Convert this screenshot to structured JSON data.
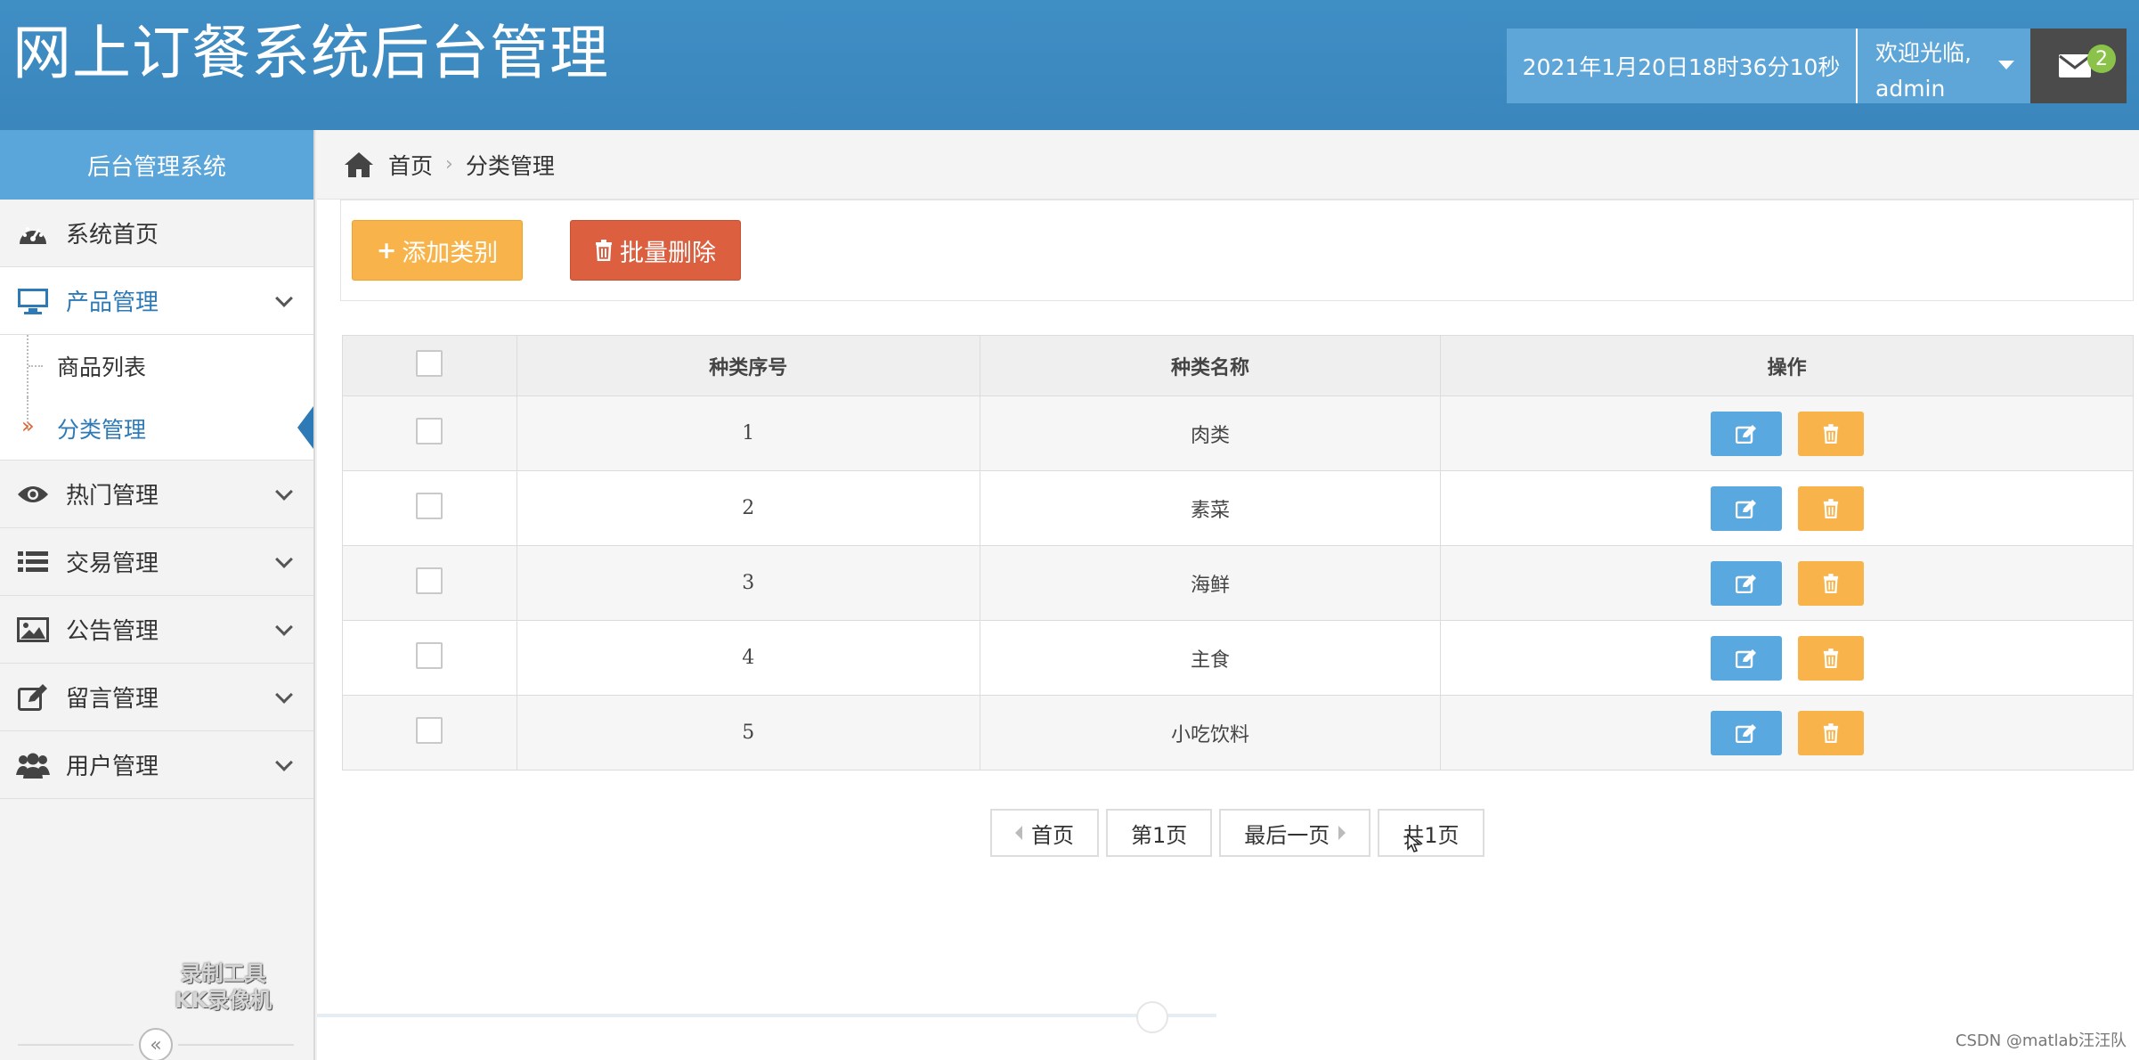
{
  "header": {
    "title": "网上订餐系统后台管理",
    "datetime": "2021年1月20日18时36分10秒",
    "welcome_line1": "欢迎光临,",
    "welcome_line2": "admin",
    "mail_count": "2"
  },
  "sidebar": {
    "title": "后台管理系统",
    "items": [
      {
        "label": "系统首页",
        "icon": "dashboard-icon"
      },
      {
        "label": "产品管理",
        "icon": "monitor-icon"
      },
      {
        "label": "热门管理",
        "icon": "eye-icon"
      },
      {
        "label": "交易管理",
        "icon": "list-icon"
      },
      {
        "label": "公告管理",
        "icon": "image-icon"
      },
      {
        "label": "留言管理",
        "icon": "edit-icon"
      },
      {
        "label": "用户管理",
        "icon": "users-icon"
      }
    ],
    "subitems": [
      {
        "label": "商品列表"
      },
      {
        "label": "分类管理"
      }
    ],
    "watermark_line1": "录制工具",
    "watermark_line2": "KK录像机",
    "collapse_glyph": "«"
  },
  "breadcrumb": {
    "home": "首页",
    "sep": "›",
    "current": "分类管理"
  },
  "toolbar": {
    "add_label": "添加类别",
    "add_icon": "+",
    "delete_label": "批量删除"
  },
  "table": {
    "columns": [
      "种类序号",
      "种类名称",
      "操作"
    ],
    "rows": [
      {
        "id": "1",
        "name": "肉类"
      },
      {
        "id": "2",
        "name": "素菜"
      },
      {
        "id": "3",
        "name": "海鲜"
      },
      {
        "id": "4",
        "name": "主食"
      },
      {
        "id": "5",
        "name": "小吃饮料"
      }
    ]
  },
  "pager": {
    "first": "首页",
    "current": "第1页",
    "last": "最后一页",
    "total": "共1页"
  },
  "footer": {
    "credit": "CSDN @matlab汪汪队"
  },
  "colors": {
    "header": "#3f8ec4",
    "accent": "#2d7ab7",
    "add_button": "#f8b44a",
    "delete_button": "#dc6040",
    "badge": "#8bc34a"
  }
}
